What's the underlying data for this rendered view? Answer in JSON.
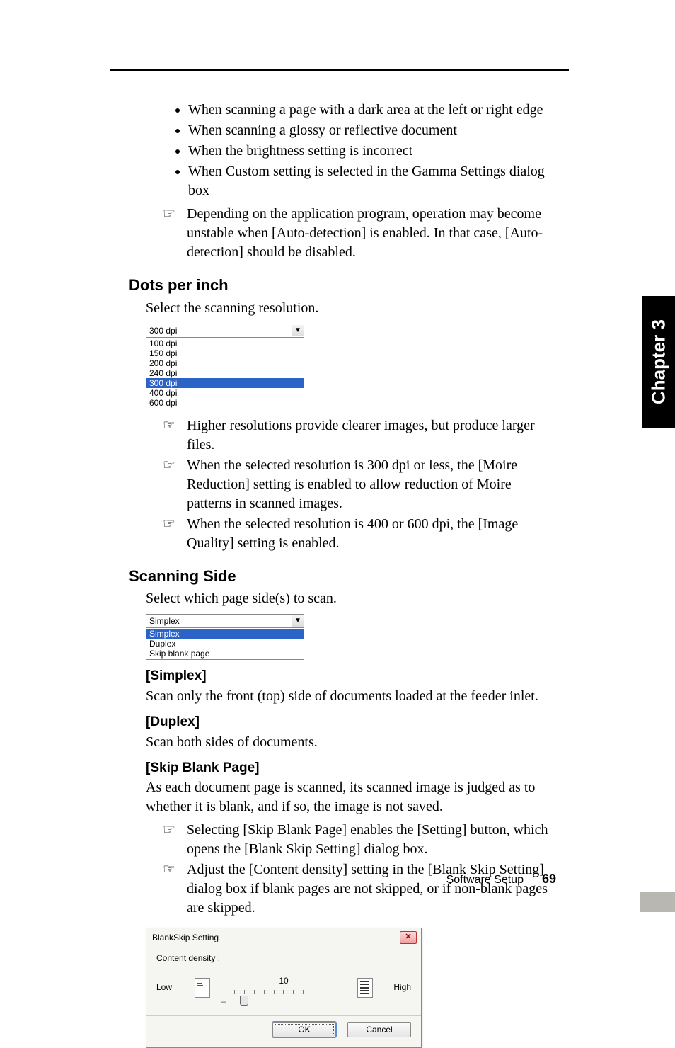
{
  "chapter_tab": "Chapter 3",
  "intro_bullets": [
    "When scanning a page with a dark area at the left or right edge",
    "When scanning a glossy or reflective document",
    "When the brightness setting is incorrect",
    "When Custom setting is selected in the Gamma Settings dialog box"
  ],
  "intro_note": "Depending on the application program, operation may become unstable when [Auto-detection] is enabled. In that case, [Auto-detection] should be disabled.",
  "dpi": {
    "heading": "Dots per inch",
    "intro": "Select the scanning resolution.",
    "selected": "300 dpi",
    "options": [
      "100 dpi",
      "150 dpi",
      "200 dpi",
      "240 dpi",
      "300 dpi",
      "400 dpi",
      "600 dpi"
    ],
    "notes": [
      "Higher resolutions provide clearer images, but produce larger files.",
      "When the selected resolution is 300 dpi or less, the [Moire Reduction] setting is enabled to allow reduction of Moire patterns in scanned images.",
      "When the selected resolution is 400 or 600 dpi, the [Image Quality] setting is enabled."
    ]
  },
  "side": {
    "heading": "Scanning Side",
    "intro": "Select which page side(s) to scan.",
    "selected": "Simplex",
    "options": [
      "Simplex",
      "Duplex",
      "Skip blank page"
    ]
  },
  "simplex": {
    "title": "[Simplex]",
    "desc": "Scan only the front (top) side of documents loaded at the feeder inlet."
  },
  "duplex": {
    "title": "[Duplex]",
    "desc": "Scan both sides of documents."
  },
  "skip": {
    "title": "[Skip Blank Page]",
    "desc": "As each document page is scanned, its scanned image is judged as to whether it is blank, and if so, the image is not saved.",
    "notes": [
      "Selecting [Skip Blank Page] enables the [Setting] button, which opens the [Blank Skip Setting] dialog box.",
      "Adjust the [Content density] setting in the [Blank Skip Setting] dialog box if blank pages are not skipped, or if non-blank pages are skipped."
    ]
  },
  "dialog": {
    "title": "BlankSkip Setting",
    "label_full": "Content density :",
    "label_prefix": "C",
    "label_rest": "ontent density :",
    "low": "Low",
    "high": "High",
    "value": "10",
    "ok": "OK",
    "cancel": "Cancel"
  },
  "footer": {
    "section": "Software Setup",
    "page": "69"
  }
}
